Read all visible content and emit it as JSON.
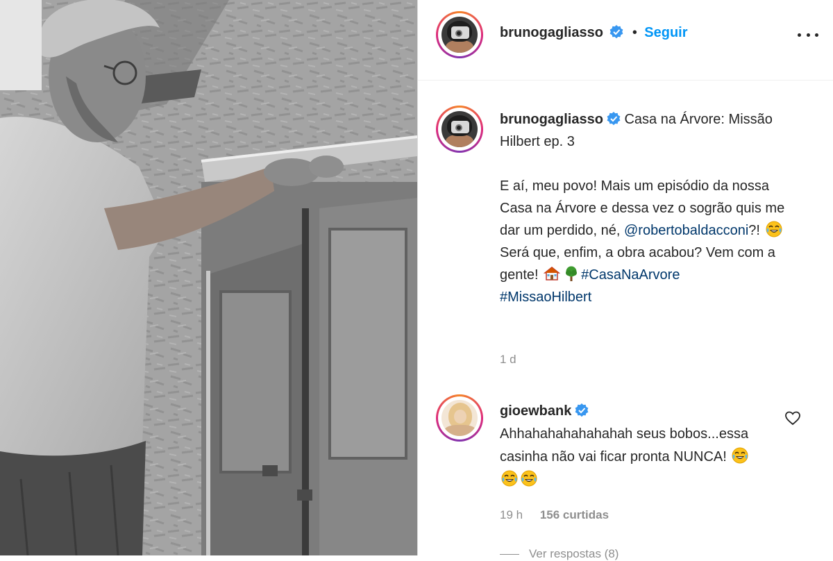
{
  "post": {
    "author": "brunogagliasso",
    "follow_label": "Seguir",
    "separator": "•",
    "caption": {
      "title": "Casa na Árvore: Missão Hilbert ep. 3",
      "body_part1": "E aí, meu povo! Mais um episódio da nossa Casa na Árvore e dessa vez o sogrão quis me dar um perdido, né, ",
      "mention": "@robertobaldacconi",
      "body_part2": "?! ",
      "body_part3": " Será que, enfim, a obra acabou? Vem com a gente! ",
      "hashtag1": "#CasaNaArvore",
      "hashtag2": "#MissaoHilbert"
    },
    "age": "1 d"
  },
  "comment": {
    "author": "gioewbank",
    "text": "Ahhahahahahahahah seus bobos...essa casinha não vai ficar pronta NUNCA! ",
    "age": "19 h",
    "likes": "156 curtidas",
    "view_replies": "Ver respostas (8)"
  },
  "icons": {
    "verified": "verified-badge-icon",
    "more": "more-options-icon",
    "heart": "heart-outline-icon",
    "laugh": "face-with-tears-of-joy-emoji",
    "house": "house-emoji",
    "tree": "tree-emoji"
  },
  "colors": {
    "link_blue": "#0095f6",
    "mention_blue": "#00376b",
    "muted": "#8e8e8e",
    "verified": "#3897f0"
  }
}
